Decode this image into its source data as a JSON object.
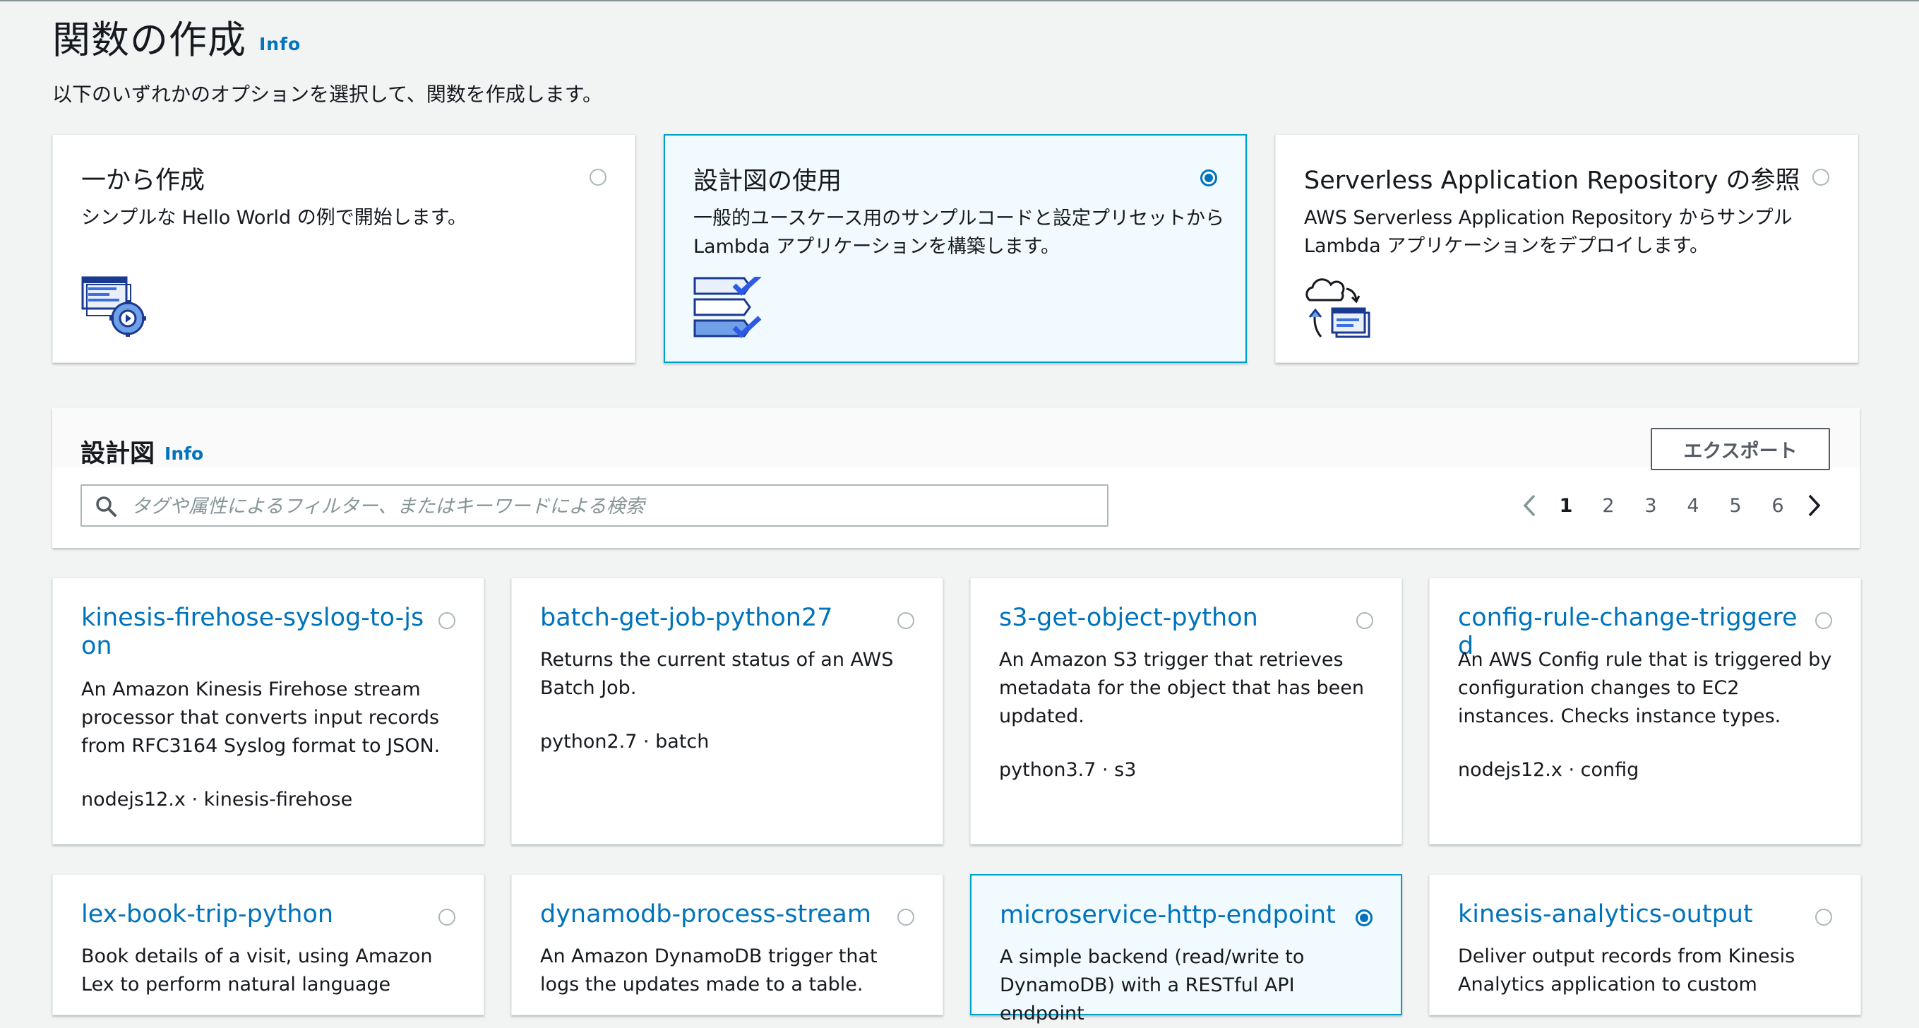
{
  "page": {
    "title": "関数の作成",
    "info_label": "Info",
    "description": "以下のいずれかのオプションを選択して、関数を作成します。"
  },
  "options": [
    {
      "title": "一から作成",
      "description": "シンプルな Hello World の例で開始します。",
      "selected": false,
      "icon": "code-gear-icon"
    },
    {
      "title": "設計図の使用",
      "description": "一般的ユースケース用のサンプルコードと設定プリセットから Lambda アプリケーションを構築します。",
      "selected": true,
      "icon": "checklist-icon"
    },
    {
      "title": "Serverless Application Repository の参照",
      "description": "AWS Serverless Application Repository からサンプル Lambda アプリケーションをデプロイします。",
      "selected": false,
      "icon": "cloud-deploy-icon"
    }
  ],
  "blueprints_panel": {
    "title": "設計図",
    "info_label": "Info",
    "export_label": "エクスポート",
    "search_placeholder": "タグや属性によるフィルター、またはキーワードによる検索",
    "pages": [
      "1",
      "2",
      "3",
      "4",
      "5",
      "6"
    ],
    "current_page": "1"
  },
  "blueprints": [
    {
      "title": "kinesis-firehose-syslog-to-json",
      "description": "An Amazon Kinesis Firehose stream processor that converts input records from RFC3164 Syslog format to JSON.",
      "tags": "nodejs12.x · kinesis-firehose",
      "selected": false
    },
    {
      "title": "batch-get-job-python27",
      "description": "Returns the current status of an AWS Batch Job.",
      "tags": "python2.7 · batch",
      "selected": false
    },
    {
      "title": "s3-get-object-python",
      "description": "An Amazon S3 trigger that retrieves metadata for the object that has been updated.",
      "tags": "python3.7 · s3",
      "selected": false
    },
    {
      "title": "config-rule-change-triggered",
      "description": "An AWS Config rule that is triggered by configuration changes to EC2 instances. Checks instance types.",
      "tags": "nodejs12.x · config",
      "selected": false
    },
    {
      "title": "lex-book-trip-python",
      "description": "Book details of a visit, using Amazon Lex to perform natural language",
      "tags": "",
      "selected": false
    },
    {
      "title": "dynamodb-process-stream",
      "description": "An Amazon DynamoDB trigger that logs the updates made to a table.",
      "tags": "",
      "selected": false
    },
    {
      "title": "microservice-http-endpoint",
      "description": "A simple backend (read/write to DynamoDB) with a RESTful API endpoint",
      "tags": "",
      "selected": true
    },
    {
      "title": "kinesis-analytics-output",
      "description": "Deliver output records from Kinesis Analytics application to custom",
      "tags": "",
      "selected": false
    }
  ],
  "colors": {
    "link": "#0073bb",
    "selected_border": "#00a1c9",
    "selected_background": "#f1faff",
    "background": "#f2f3f3"
  }
}
